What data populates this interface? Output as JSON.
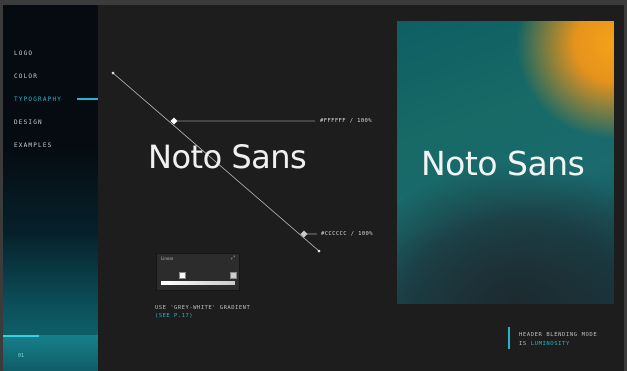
{
  "sidebar": {
    "items": [
      {
        "label": "LOGO"
      },
      {
        "label": "COLOR"
      },
      {
        "label": "TYPOGRAPHY"
      },
      {
        "label": "DESIGN"
      },
      {
        "label": "EXAMPLES"
      }
    ],
    "active_index": 2,
    "page_number": "01"
  },
  "canvas": {
    "sample_text": "Noto Sans",
    "stop_top_label": "#FFFFFF / 100%",
    "stop_bottom_label": "#CCCCCC / 100%",
    "gradient_panel_title": "Linear",
    "note_line1": "USE 'GREY-WHITE' GRADIENT",
    "note_link": "(SEE P.17)"
  },
  "preview": {
    "sample_text": "Noto Sans",
    "note_line1": "HEADER BLENDING MODE",
    "note_line2_prefix": "IS",
    "note_line2_accent": "LUMINOSITY"
  },
  "colors": {
    "accent": "#22b6c8",
    "background": "#1d1d1e",
    "gradient_orange": "#f4a21a",
    "gradient_teal": "#176a66"
  }
}
